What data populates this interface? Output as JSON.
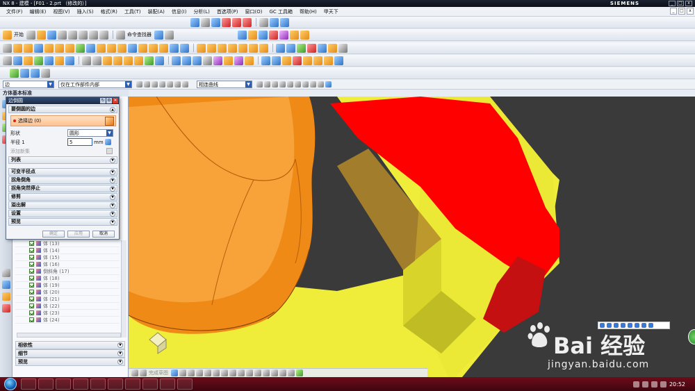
{
  "app": {
    "title": "NX 8 - 建模 - [F01 - 2.prt （修改的）]",
    "brand": "SIEMENS"
  },
  "menu": [
    "文件(F)",
    "编辑(E)",
    "视图(V)",
    "插入(S)",
    "格式(R)",
    "工具(T)",
    "装配(A)",
    "信息(I)",
    "分析(L)",
    "首选项(P)",
    "窗口(O)",
    "GC 工具箱",
    "帮助(H)",
    "甲天下"
  ],
  "toolbar": {
    "start_label": "开始",
    "command_finder_label": "命令查找器"
  },
  "selection_bar": {
    "filter_value": "边",
    "scope_value": "仅在工作部件内部",
    "curve_rule_value": "相连曲线"
  },
  "navigator": {
    "title": "方体基本标准",
    "tree_items": [
      "体 (13)",
      "体 (14)",
      "体 (15)",
      "体 (16)",
      "倒斜角 (17)",
      "体 (18)",
      "体 (19)",
      "体 (20)",
      "体 (21)",
      "体 (22)",
      "体 (23)",
      "体 (24)"
    ],
    "sections": [
      "相依性",
      "细节",
      "预览"
    ]
  },
  "dialog": {
    "title": "边倒圆",
    "group_edges": "要倒圆的边",
    "select_edge": "选择边 (0)",
    "shape_label": "形状",
    "shape_value": "圆形",
    "radius_label": "半径 1",
    "radius_value": "5",
    "radius_unit": "mm",
    "add_set_label": "添加新集",
    "list_label": "列表",
    "collapsed_groups": [
      "可变半径点",
      "拐角倒角",
      "拐角突然停止",
      "修剪",
      "溢出解",
      "设置",
      "预览"
    ],
    "ok_label": "确定",
    "apply_label": "应用",
    "cancel_label": "取消"
  },
  "bottom_toolbar": {
    "sketch_label": "完成草图"
  },
  "watermark": {
    "logo_text": "Bai 经验",
    "url": "jingyan.baidu.com"
  },
  "taskbar": {
    "time": "20:52"
  },
  "colors": {
    "part_orange": "#f08a17",
    "face_red": "#ff0000",
    "face_yellow": "#f0ec3a",
    "selection_highlight": "#ffc190"
  }
}
